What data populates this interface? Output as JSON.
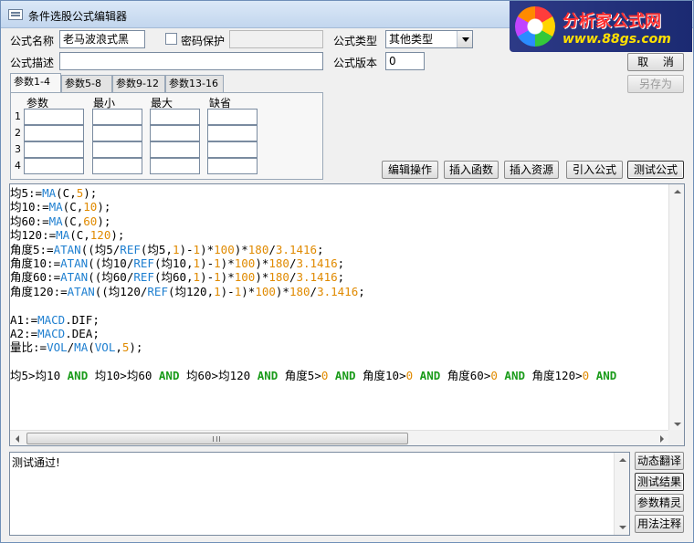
{
  "window": {
    "title": "条件选股公式编辑器"
  },
  "logo": {
    "line1": "分析家公式网",
    "line2": "www.88gs.com"
  },
  "form": {
    "name_label": "公式名称",
    "name_value": "老马波浪式黑",
    "password_label": "密码保护",
    "password_checked": false,
    "password_value": "",
    "type_label": "公式类型",
    "type_value": "其他类型",
    "desc_label": "公式描述",
    "desc_value": "",
    "version_label": "公式版本",
    "version_value": "0"
  },
  "buttons": {
    "cancel": "取 消",
    "save_as": "另存为",
    "edit_ops": "编辑操作",
    "insert_func": "插入函数",
    "insert_res": "插入资源",
    "import_formula": "引入公式",
    "test_formula": "测试公式",
    "dyn_translate": "动态翻译",
    "test_result": "测试结果",
    "param_wizard": "参数精灵",
    "usage_notes": "用法注释"
  },
  "tabs": [
    "参数1-4",
    "参数5-8",
    "参数9-12",
    "参数13-16"
  ],
  "params": {
    "headers": [
      "参数",
      "最小",
      "最大",
      "缺省"
    ],
    "rows": [
      "1",
      "2",
      "3",
      "4"
    ]
  },
  "code_lines": [
    [
      [
        "v",
        "均5:="
      ],
      [
        "f",
        "MA"
      ],
      [
        "o",
        "(C,"
      ],
      [
        "n",
        "5"
      ],
      [
        "o",
        ");"
      ]
    ],
    [
      [
        "v",
        "均10:="
      ],
      [
        "f",
        "MA"
      ],
      [
        "o",
        "(C,"
      ],
      [
        "n",
        "10"
      ],
      [
        "o",
        ");"
      ]
    ],
    [
      [
        "v",
        "均60:="
      ],
      [
        "f",
        "MA"
      ],
      [
        "o",
        "(C,"
      ],
      [
        "n",
        "60"
      ],
      [
        "o",
        ");"
      ]
    ],
    [
      [
        "v",
        "均120:="
      ],
      [
        "f",
        "MA"
      ],
      [
        "o",
        "(C,"
      ],
      [
        "n",
        "120"
      ],
      [
        "o",
        ");"
      ]
    ],
    [
      [
        "v",
        "角度5:="
      ],
      [
        "f",
        "ATAN"
      ],
      [
        "o",
        "((均5/"
      ],
      [
        "f",
        "REF"
      ],
      [
        "o",
        "(均5,"
      ],
      [
        "n",
        "1"
      ],
      [
        "o",
        ")-"
      ],
      [
        "n",
        "1"
      ],
      [
        "o",
        ")*"
      ],
      [
        "n",
        "100"
      ],
      [
        "o",
        ")*"
      ],
      [
        "n",
        "180"
      ],
      [
        "o",
        "/"
      ],
      [
        "n",
        "3.1416"
      ],
      [
        "o",
        ";"
      ]
    ],
    [
      [
        "v",
        "角度10:="
      ],
      [
        "f",
        "ATAN"
      ],
      [
        "o",
        "((均10/"
      ],
      [
        "f",
        "REF"
      ],
      [
        "o",
        "(均10,"
      ],
      [
        "n",
        "1"
      ],
      [
        "o",
        ")-"
      ],
      [
        "n",
        "1"
      ],
      [
        "o",
        ")*"
      ],
      [
        "n",
        "100"
      ],
      [
        "o",
        ")*"
      ],
      [
        "n",
        "180"
      ],
      [
        "o",
        "/"
      ],
      [
        "n",
        "3.1416"
      ],
      [
        "o",
        ";"
      ]
    ],
    [
      [
        "v",
        "角度60:="
      ],
      [
        "f",
        "ATAN"
      ],
      [
        "o",
        "((均60/"
      ],
      [
        "f",
        "REF"
      ],
      [
        "o",
        "(均60,"
      ],
      [
        "n",
        "1"
      ],
      [
        "o",
        ")-"
      ],
      [
        "n",
        "1"
      ],
      [
        "o",
        ")*"
      ],
      [
        "n",
        "100"
      ],
      [
        "o",
        ")*"
      ],
      [
        "n",
        "180"
      ],
      [
        "o",
        "/"
      ],
      [
        "n",
        "3.1416"
      ],
      [
        "o",
        ";"
      ]
    ],
    [
      [
        "v",
        "角度120:="
      ],
      [
        "f",
        "ATAN"
      ],
      [
        "o",
        "((均120/"
      ],
      [
        "f",
        "REF"
      ],
      [
        "o",
        "(均120,"
      ],
      [
        "n",
        "1"
      ],
      [
        "o",
        ")-"
      ],
      [
        "n",
        "1"
      ],
      [
        "o",
        ")*"
      ],
      [
        "n",
        "100"
      ],
      [
        "o",
        ")*"
      ],
      [
        "n",
        "180"
      ],
      [
        "o",
        "/"
      ],
      [
        "n",
        "3.1416"
      ],
      [
        "o",
        ";"
      ]
    ],
    [],
    [
      [
        "v",
        "A1:="
      ],
      [
        "f",
        "MACD"
      ],
      [
        "o",
        ".DIF;"
      ]
    ],
    [
      [
        "v",
        "A2:="
      ],
      [
        "f",
        "MACD"
      ],
      [
        "o",
        ".DEA;"
      ]
    ],
    [
      [
        "v",
        "量比:="
      ],
      [
        "f",
        "VOL"
      ],
      [
        "o",
        "/"
      ],
      [
        "f",
        "MA"
      ],
      [
        "o",
        "("
      ],
      [
        "f",
        "VOL"
      ],
      [
        "o",
        ","
      ],
      [
        "n",
        "5"
      ],
      [
        "o",
        ");"
      ]
    ],
    [],
    [
      [
        "v",
        "均5>均10 "
      ],
      [
        "k",
        "AND"
      ],
      [
        "v",
        " 均10>均60 "
      ],
      [
        "k",
        "AND"
      ],
      [
        "v",
        " 均60>均120 "
      ],
      [
        "k",
        "AND"
      ],
      [
        "v",
        " 角度5>"
      ],
      [
        "n",
        "0"
      ],
      [
        "k",
        " AND"
      ],
      [
        "v",
        " 角度10>"
      ],
      [
        "n",
        "0"
      ],
      [
        "k",
        " AND"
      ],
      [
        "v",
        " 角度60>"
      ],
      [
        "n",
        "0"
      ],
      [
        "k",
        " AND"
      ],
      [
        "v",
        " 角度120>"
      ],
      [
        "n",
        "0"
      ],
      [
        "k",
        " AND"
      ]
    ]
  ],
  "output": {
    "text": "测试通过!"
  }
}
